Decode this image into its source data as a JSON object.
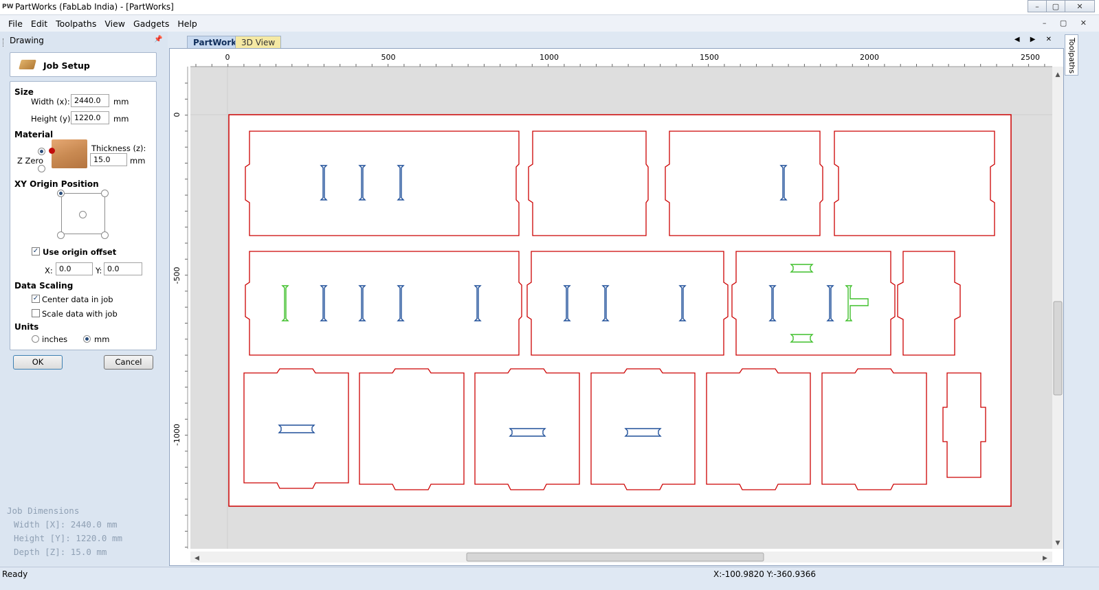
{
  "window": {
    "app_icon": "PW",
    "title": "PartWorks (FabLab India) - [PartWorks]",
    "buttons": {
      "minimize": "–",
      "maximize": "▢",
      "close": "✕"
    }
  },
  "menu": {
    "items": [
      "File",
      "Edit",
      "Toolpaths",
      "View",
      "Gadgets",
      "Help"
    ],
    "mdi_controls": "– ▢ ✕"
  },
  "panel": {
    "header": "Drawing",
    "pin_icon": "pin-icon",
    "job_setup_label": "Job Setup",
    "size": {
      "section": "Size",
      "width_label": "Width (x):",
      "width_value": "2440.0",
      "height_label": "Height (y):",
      "height_value": "1220.0",
      "unit": "mm"
    },
    "material": {
      "section": "Material",
      "thickness_label": "Thickness (z):",
      "thickness_value": "15.0",
      "unit": "mm",
      "zzero_label": "Z Zero"
    },
    "xy_origin": {
      "section": "XY Origin Position",
      "use_offset_label": "Use origin offset",
      "use_offset_checked": true,
      "x_label": "X:",
      "x_value": "0.0",
      "y_label": "Y:",
      "y_value": "0.0"
    },
    "scaling": {
      "section": "Data Scaling",
      "center_label": "Center data in job",
      "center_checked": true,
      "scale_label": "Scale data with job",
      "scale_checked": false
    },
    "units": {
      "section": "Units",
      "inches_label": "inches",
      "mm_label": "mm",
      "selected": "mm"
    },
    "ok_label": "OK",
    "cancel_label": "Cancel",
    "job_dimensions": {
      "heading": "Job Dimensions",
      "width": "Width  [X]: 2440.0 mm",
      "height": "Height [Y]: 1220.0 mm",
      "depth": "Depth  [Z]: 15.0 mm"
    }
  },
  "tabs": [
    {
      "label": "PartWorks",
      "active": true
    },
    {
      "label": "3D View",
      "active": false
    }
  ],
  "tab_arrows": "◀ ▶ ✕",
  "side_tab": "Toolpaths",
  "rulers": {
    "horizontal_labels": [
      "0",
      "500",
      "1000",
      "1500",
      "2000",
      "2500"
    ],
    "vertical_labels": [
      "0",
      "-500",
      "-1000"
    ]
  },
  "colors": {
    "vector_red": "#cc0000",
    "vector_blue": "#1f4f99",
    "vector_green": "#3fbf2a",
    "canvas_bg": "#dedede",
    "tab_active": "#c9daf0",
    "tab_inactive": "#f5e9a4"
  },
  "status": {
    "text": "Ready",
    "coordinates": "X:-100.9820 Y:-360.9366"
  }
}
